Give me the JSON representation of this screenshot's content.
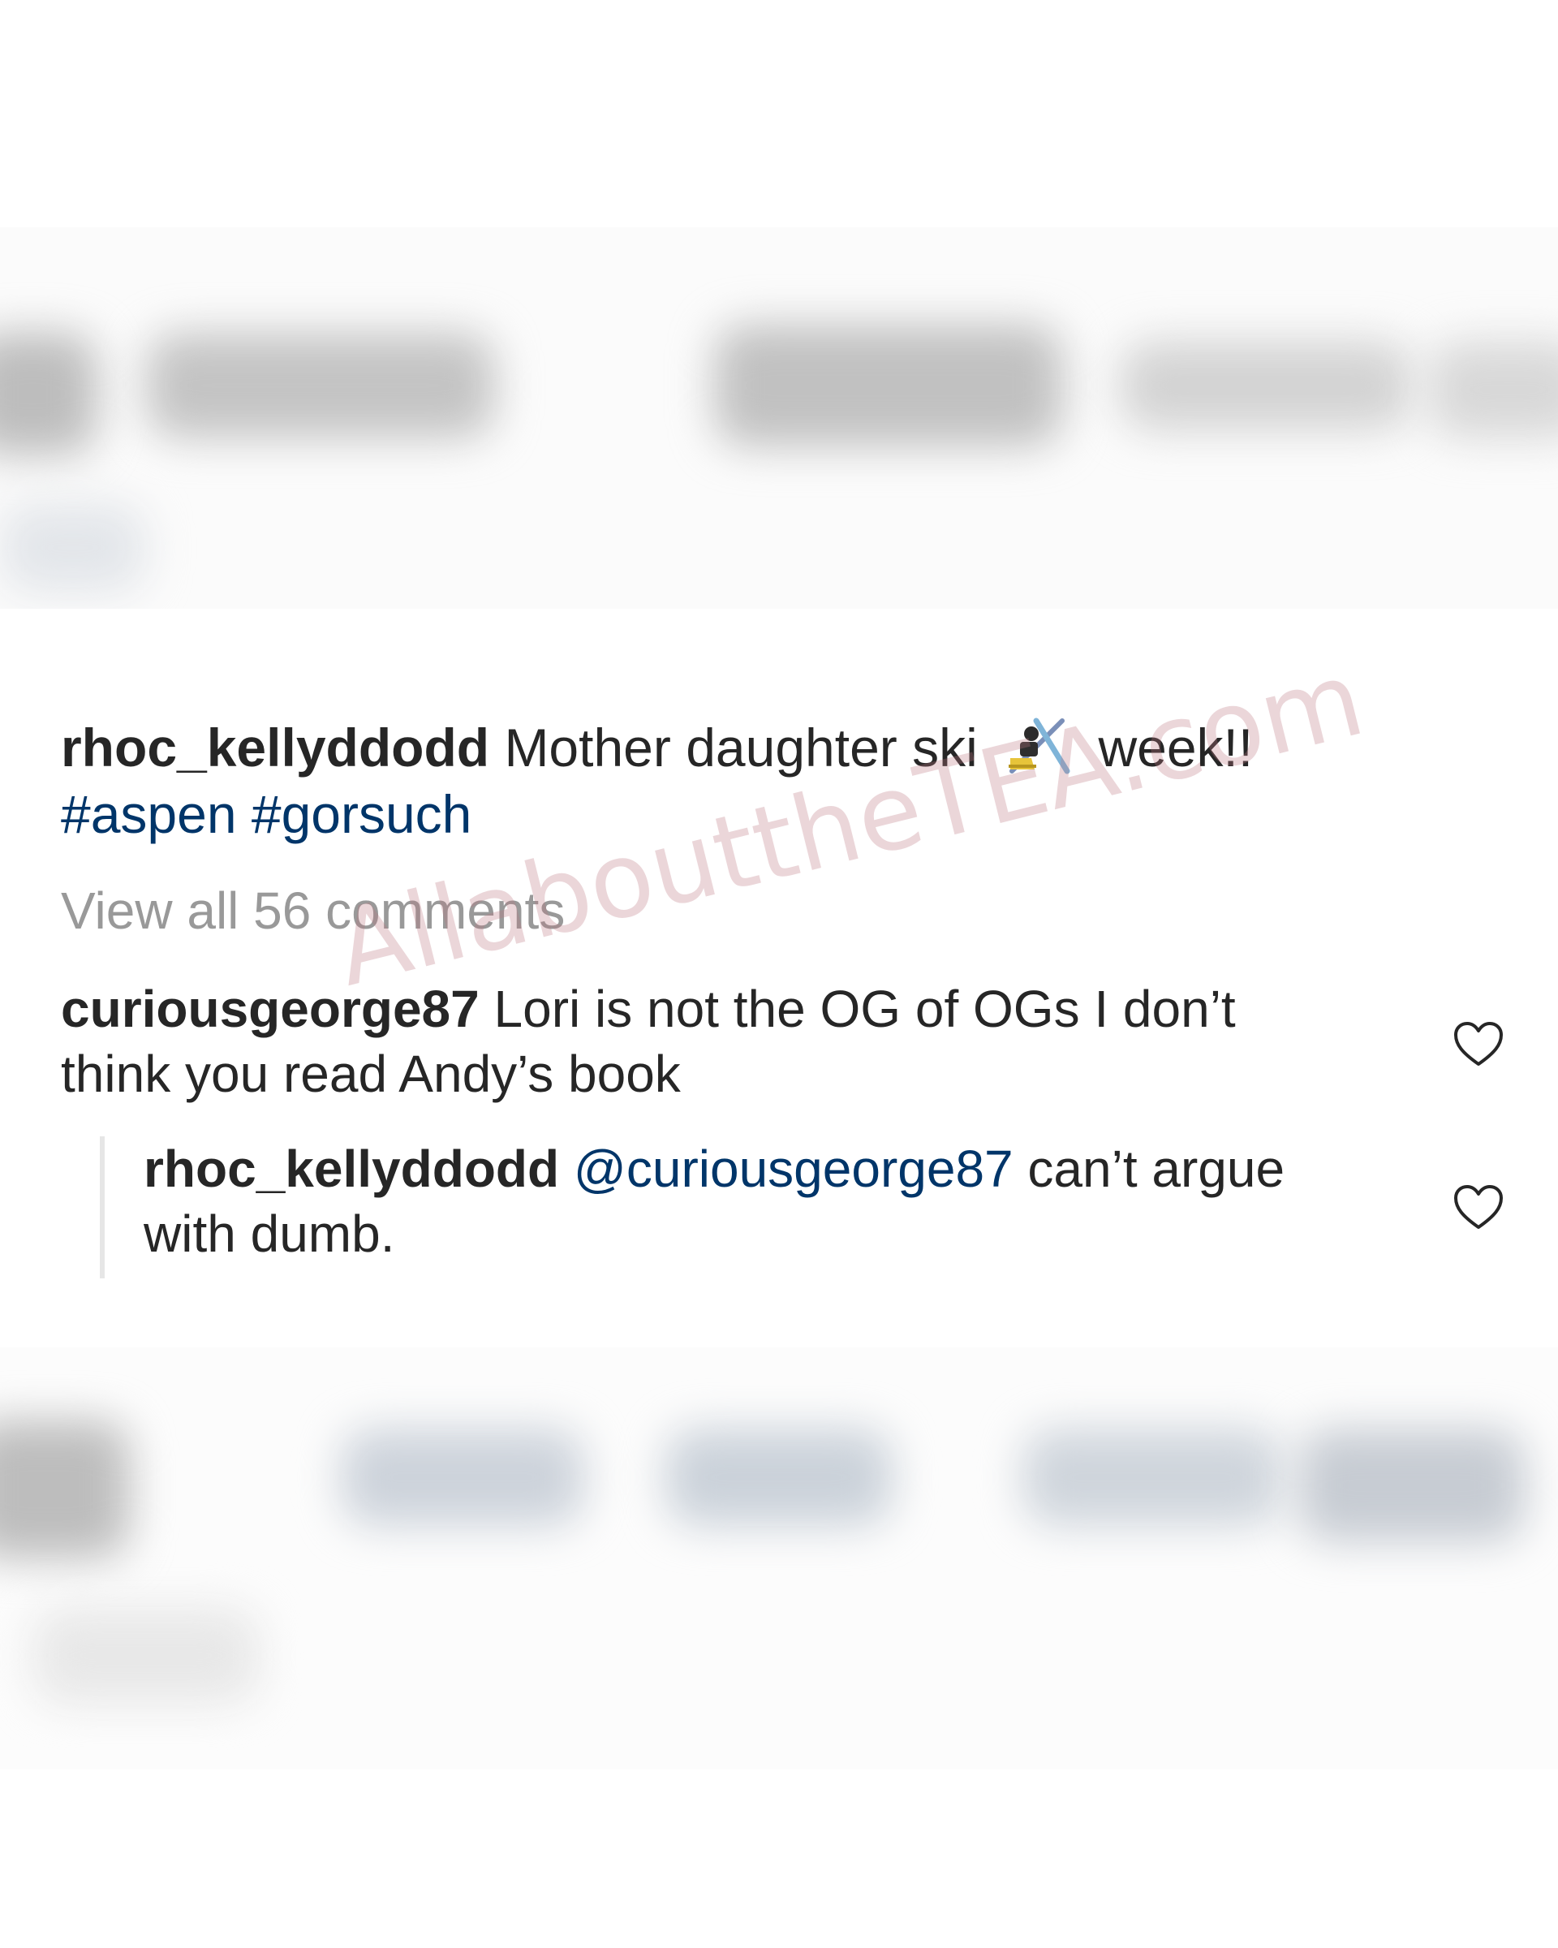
{
  "post": {
    "author": "rhoc_kellyddodd",
    "caption_text": "Mother daughter ski",
    "caption_after_emoji": "week!!",
    "emoji": "skier-emoji",
    "hashtags": [
      "#aspen",
      "#gorsuch"
    ]
  },
  "view_all_comments": "View all 56 comments",
  "comments": [
    {
      "username": "curiousgeorge87",
      "text": "Lori is not the OG of OGs I don’t think you read Andy’s book",
      "like_icon": "heart-outline-icon"
    }
  ],
  "replies": [
    {
      "username": "rhoc_kellyddodd",
      "mention": "@curiousgeorge87",
      "text": "can’t argue with dumb.",
      "like_icon": "heart-outline-icon"
    }
  ],
  "watermark": "AllabouttheTEA.com",
  "colors": {
    "text": "#262626",
    "link": "#003569",
    "muted": "#999999",
    "watermark": "#be7882"
  }
}
